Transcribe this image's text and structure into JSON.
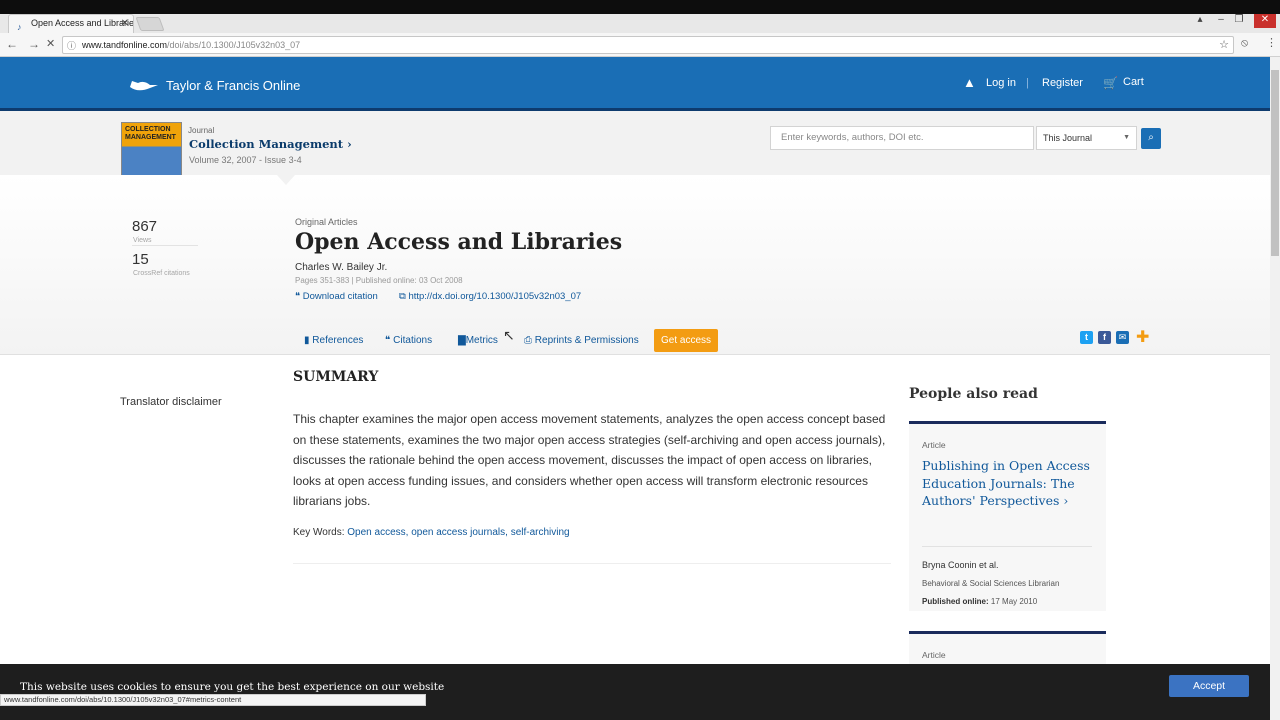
{
  "browser": {
    "tab_title": "Open Access and Librarie",
    "url_host": "www.tandfonline.com",
    "url_path": "/doi/abs/10.1300/J105v32n03_07",
    "status_url": "www.tandfonline.com/doi/abs/10.1300/J105v32n03_07#metrics-content"
  },
  "header": {
    "logo": "Taylor & Francis Online",
    "login": "Log in",
    "register": "Register",
    "cart": "Cart"
  },
  "journal": {
    "cover_text": "COLLECTION MANAGEMENT",
    "label": "Journal",
    "name": "Collection Management",
    "volume": "Volume 32, 2007 - Issue 3-4"
  },
  "search": {
    "placeholder": "Enter keywords, authors, DOI etc.",
    "scope": "This Journal"
  },
  "stats": {
    "views_value": "867",
    "views_label": "Views",
    "citations_value": "15",
    "citations_label": "CrossRef citations"
  },
  "article": {
    "section": "Original Articles",
    "title": "Open Access and Libraries",
    "author": "Charles W. Bailey Jr.",
    "pub_info": "Pages 351-383 | Published online: 03 Oct 2008",
    "download_citation": "Download citation",
    "doi": "http://dx.doi.org/10.1300/J105v32n03_07"
  },
  "tabs": {
    "references": "References",
    "citations": "Citations",
    "metrics": "Metrics",
    "reprints": "Reprints & Permissions",
    "get_access": "Get access"
  },
  "body": {
    "translator": "Translator disclaimer",
    "summary_heading": "SUMMARY",
    "abstract": "This chapter examines the major open access movement statements, analyzes the open access concept based on these statements, examines the two major open access strategies (self-archiving and open access journals), discusses the rationale behind the open access movement, discusses the impact of open access on libraries, looks at open access funding issues, and considers whether open access will transform electronic resources librarians jobs.",
    "keywords_label": "Key Words: ",
    "keywords": "Open access, open access journals, self-archiving"
  },
  "sidebar": {
    "heading": "People also read",
    "cards": [
      {
        "type": "Article",
        "title": "Publishing in Open Access Education Journals: The Authors' Perspectives",
        "author": "Bryna Coonin et al.",
        "journal": "Behavioral & Social Sciences Librarian",
        "pub_label": "Published online:",
        "pub_date": "17 May 2010"
      },
      {
        "type": "Article"
      }
    ]
  },
  "cookie": {
    "text": "This website uses cookies to ensure you get the best experience on our website",
    "accept": "Accept"
  },
  "colors": {
    "brand_blue": "#1a6eb5",
    "navy": "#0e3b6e",
    "link": "#10589a",
    "accent_orange": "#f39c12"
  }
}
